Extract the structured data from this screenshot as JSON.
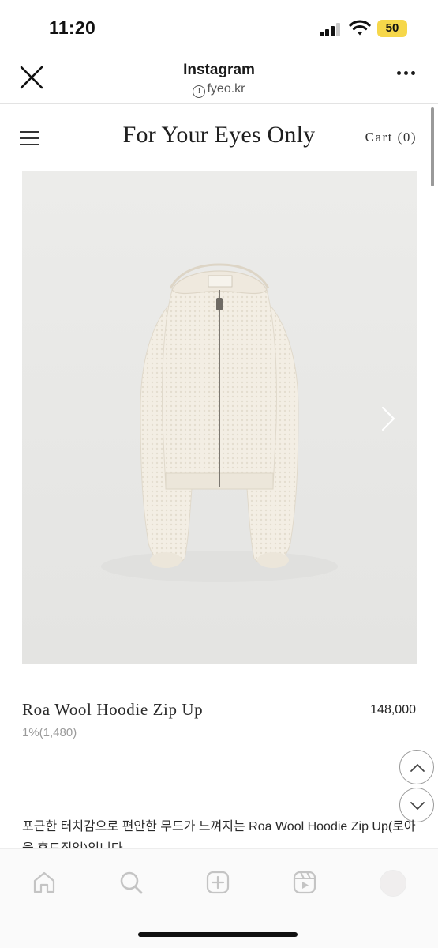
{
  "status_bar": {
    "time": "11:20",
    "battery": "50",
    "battery_color": "#f6d74a"
  },
  "browser_header": {
    "title": "Instagram",
    "domain": "fyeo.kr",
    "close_icon": "close-icon",
    "more_icon": "more-icon"
  },
  "site": {
    "brand": "For Your Eyes Only",
    "cart": "Cart (0)",
    "menu_icon": "hamburger-menu-icon"
  },
  "product": {
    "name": "Roa Wool Hoodie Zip Up",
    "price": "148,000",
    "points": "1%(1,480)",
    "image": "cream-wool-hoodie-zip-up-photo",
    "image_background": "#e9e9e7",
    "garment_color": "#f2ede3"
  },
  "description": {
    "line1": "포근한 터치감으로 편안한 무드가 느껴지는 Roa Wool Hoodie Zip Up(로아",
    "line2": "울 후드집업)입니다."
  },
  "tab_bar": {
    "items": [
      "home-icon",
      "search-icon",
      "create-icon",
      "reels-icon",
      "profile-avatar"
    ]
  }
}
